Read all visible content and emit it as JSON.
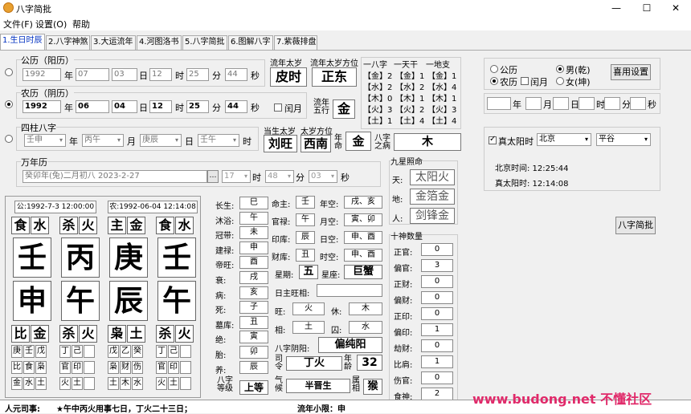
{
  "window": {
    "title": "八字简批",
    "minimize": "—",
    "maximize": "☐",
    "close": "✕"
  },
  "menu": [
    "文件(F)",
    "设置(O)",
    "帮助"
  ],
  "tabs": [
    "1.生日时辰",
    "2.八字神煞",
    "3.大运流年",
    "4.河图洛书",
    "5.八字简批",
    "6.图解八字",
    "7.紫薇排盘"
  ],
  "solar": {
    "label": "公历（阳历）",
    "year": "1992",
    "month": "07",
    "day": "03",
    "hour": "12",
    "minute": "25",
    "second": "44"
  },
  "lunar": {
    "label": "农历（阴历）",
    "year": "1992",
    "month": "06",
    "day": "04",
    "hour": "12",
    "minute": "25",
    "second": "44",
    "leap_label": "闰月"
  },
  "units": {
    "year": "年",
    "month": "月",
    "day": "日",
    "hour": "时",
    "minute": "分",
    "second": "秒"
  },
  "flow_year": {
    "taisui_label": "流年太岁",
    "taisui": "皮时",
    "fangwei_label": "流年太岁方位",
    "fangwei": "正东",
    "wuxing_label": "流年五行",
    "wuxing": "金"
  },
  "wuxing_table": {
    "headers": [
      "一八字",
      "一天干",
      "一地支"
    ],
    "rows": [
      [
        "【金】2",
        "【金】1",
        "【金】1"
      ],
      [
        "【水】2",
        "【水】2",
        "【水】4"
      ],
      [
        "【木】0",
        "【木】1",
        "【木】1"
      ],
      [
        "【火】3",
        "【火】2",
        "【火】3"
      ],
      [
        "【土】1",
        "【土】4",
        "【土】4"
      ]
    ]
  },
  "sizhu": {
    "label": "四柱八字",
    "year": "壬申",
    "month": "丙午",
    "day": "庚辰",
    "hour": "壬午",
    "shengtaisui_label": "当生太岁",
    "shengtaisui": "刘旺",
    "fangwei_label": "太岁方位",
    "fangwei": "西南",
    "nianming_label": "年命",
    "nianming": "金",
    "bingzhu_label": "八字之病",
    "bingzhu": "木"
  },
  "wannian": {
    "label": "万年历",
    "date": "癸卯年(兔)二月初八 2023-2-27",
    "h": "17",
    "m": "48",
    "s": "03"
  },
  "options": {
    "gongli": "公历",
    "nongli": "农历",
    "runyue": "闰月",
    "male": "男(乾)",
    "female": "女(坤)",
    "save_btn": "喜用设置"
  },
  "trueSolar": {
    "chk": "真太阳时",
    "city": "北京",
    "district": "平谷",
    "beijing_time": "北京时间: 12:25:44",
    "true_time": "真太阳时: 12:14:08"
  },
  "jianpi_btn": "八字简批",
  "jiuxing": {
    "label": "九星照命",
    "items": [
      [
        "天:",
        "太阳火"
      ],
      [
        "地:",
        "金箔金"
      ],
      [
        "人:",
        "剑锋金"
      ]
    ]
  },
  "shishen": {
    "label": "十神数量",
    "items": [
      [
        "正官:",
        "0"
      ],
      [
        "偏官:",
        "3"
      ],
      [
        "正财:",
        "0"
      ],
      [
        "偏财:",
        "0"
      ],
      [
        "正印:",
        "0"
      ],
      [
        "偏印:",
        "1"
      ],
      [
        "劫财:",
        "0"
      ],
      [
        "比肩:",
        "1"
      ],
      [
        "伤官:",
        "0"
      ],
      [
        "食神:",
        "2"
      ]
    ]
  },
  "bazi": {
    "gong": "公:1992-7-3 12:00:00",
    "nong": "农:1992-06-04 12:14:08",
    "shishen_top": [
      "食",
      "水",
      "杀",
      "火",
      "主",
      "金",
      "食",
      "水"
    ],
    "tiangan": [
      "壬",
      "丙",
      "庚",
      "壬"
    ],
    "dizhi": [
      "申",
      "午",
      "辰",
      "午"
    ],
    "shishen_bot": [
      "比",
      "金",
      "杀",
      "火",
      "枭",
      "土",
      "杀",
      "火"
    ],
    "canggan": [
      [
        "庚",
        "壬",
        "戊"
      ],
      [
        "丁",
        "己",
        ""
      ],
      [
        "戊",
        "乙",
        "癸"
      ],
      [
        "丁",
        "己",
        ""
      ]
    ],
    "canggan_ss": [
      [
        "比",
        "食",
        "枭"
      ],
      [
        "官",
        "印",
        ""
      ],
      [
        "枭",
        "财",
        "伤"
      ],
      [
        "官",
        "印",
        ""
      ]
    ],
    "canggan_wx": [
      [
        "金",
        "水",
        "土"
      ],
      [
        "火",
        "土",
        ""
      ],
      [
        "土",
        "木",
        "水"
      ],
      [
        "火",
        "土",
        ""
      ]
    ]
  },
  "changsheng": [
    [
      "长生:",
      "巳"
    ],
    [
      "沐浴:",
      "午"
    ],
    [
      "冠带:",
      "未"
    ],
    [
      "建禄:",
      "申"
    ],
    [
      "帝旺:",
      "酉"
    ],
    [
      "衰:",
      "戌"
    ],
    [
      "病:",
      "亥"
    ],
    [
      "死:",
      "子"
    ],
    [
      "墓库:",
      "丑"
    ],
    [
      "绝:",
      "寅"
    ],
    [
      "胎:",
      "卯"
    ],
    [
      "养:",
      "辰"
    ]
  ],
  "mingzhu": {
    "minggong_label": "命主:",
    "minggong": "壬",
    "nk_label": "年空:",
    "nk": "戌、亥",
    "guan_label": "官禄:",
    "guan": "午",
    "yk_label": "月空:",
    "yk": "寅、卯",
    "yin_label": "印库:",
    "yin": "辰",
    "rk_label": "日空:",
    "rk": "申、酉",
    "cai_label": "财库:",
    "cai": "丑",
    "sk_label": "时空:",
    "sk": "申、酉",
    "xq_label": "星期:",
    "xq": "五",
    "xz_label": "星座:",
    "xz": "巨蟹",
    "rz_label": "日主旺相:",
    "wang_label": "旺:",
    "wang": "火",
    "xiu_label": "休:",
    "xiu": "木",
    "xiang_label": "相:",
    "xiang": "土",
    "qiu_label": "囚:",
    "qiu": "水",
    "nayin_label": "八字阴阳:",
    "nayin": "偏纯阳",
    "siling_label": "司令",
    "siling": "丁火",
    "nianling_label": "年龄",
    "nianling": "32",
    "dengji_label": "八字等级",
    "dengji": "上等",
    "qihou_label": "气候",
    "qihou": "半晋生",
    "shuxiang_label": "属相",
    "shuxiang": "猴"
  },
  "status": {
    "left": "人元司事:",
    "mid": "★午中丙火用事七日，丁火二十三日；",
    "liunian": "流年小限：申"
  },
  "watermark": "www.budong.net 不懂社区"
}
